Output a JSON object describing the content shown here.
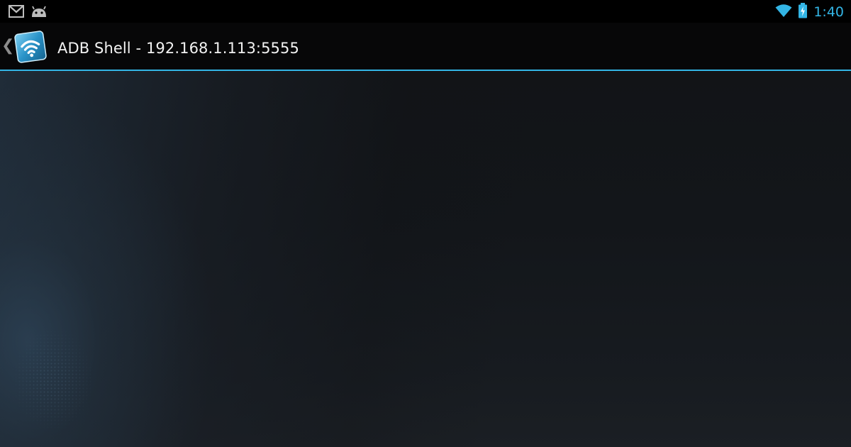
{
  "status_bar": {
    "notifications": [
      {
        "icon": "gmail-icon"
      },
      {
        "icon": "android-debug-icon"
      }
    ],
    "wifi_icon": "wifi-icon",
    "battery_icon": "battery-charging-icon",
    "time": "1:40"
  },
  "action_bar": {
    "up_caret": "❮",
    "app_icon": "adb-wireless-app-icon",
    "title": "ADB Shell - 192.168.1.113:5555"
  },
  "colors": {
    "accent": "#33b5e5",
    "action_bar_bg": "#070708",
    "status_bar_bg": "#000000",
    "title_text": "#f2f2f2"
  }
}
